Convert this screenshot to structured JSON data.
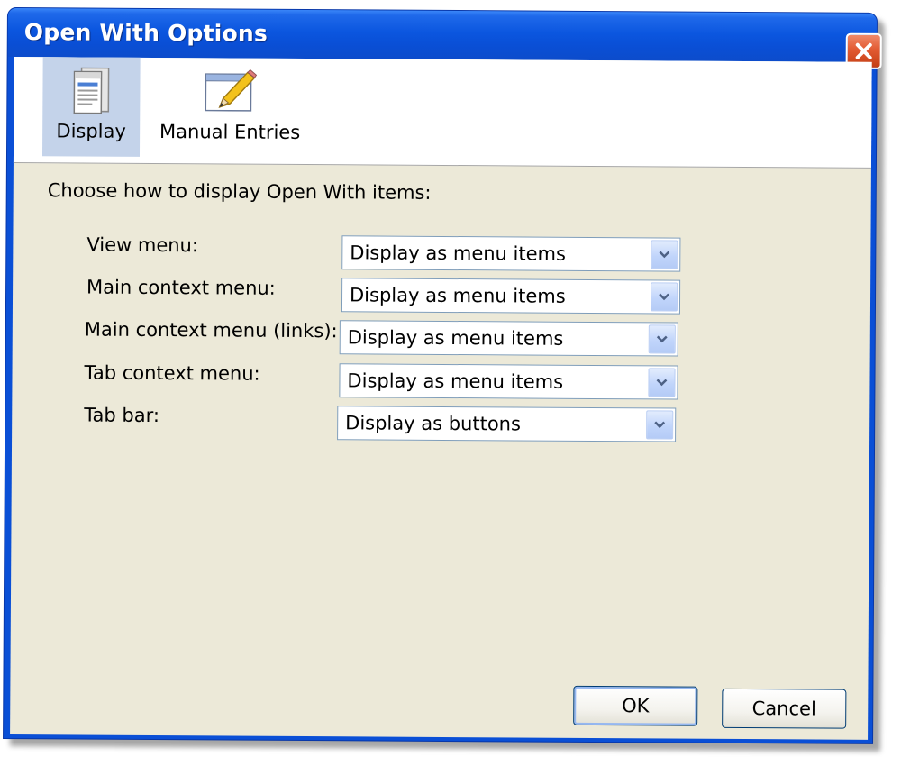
{
  "window": {
    "title": "Open With Options"
  },
  "toolbar": {
    "items": [
      {
        "label": "Display",
        "icon": "display-icon",
        "selected": true
      },
      {
        "label": "Manual Entries",
        "icon": "pencil-edit-icon",
        "selected": false
      }
    ]
  },
  "main": {
    "intro": "Choose how to display Open With items:",
    "rows": [
      {
        "label": "View menu:",
        "value": "Display as menu items"
      },
      {
        "label": "Main context menu:",
        "value": "Display as menu items"
      },
      {
        "label": "Main context menu (links):",
        "value": "Display as menu items"
      },
      {
        "label": "Tab context menu:",
        "value": "Display as menu items"
      },
      {
        "label": "Tab bar:",
        "value": "Display as buttons"
      }
    ]
  },
  "buttons": {
    "ok": "OK",
    "cancel": "Cancel"
  },
  "colors": {
    "titlebar": "#0a4fd6",
    "client": "#ece9d8",
    "selected_tab": "#c4d3ea",
    "close_button": "#e25a32"
  }
}
